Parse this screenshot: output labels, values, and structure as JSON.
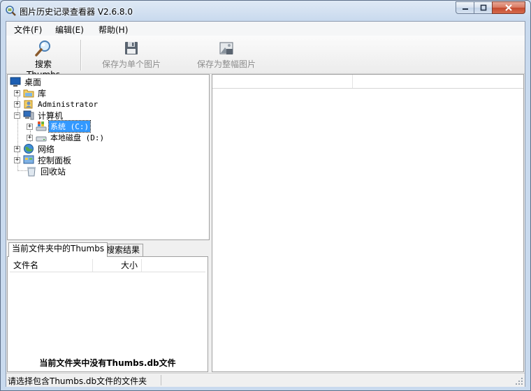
{
  "window": {
    "title": "图片历史记录查看器 V2.6.8.0"
  },
  "menu": {
    "file": "文件(F)",
    "edit": "编辑(E)",
    "help": "帮助(H)"
  },
  "toolbar": {
    "search_label": "搜索Thumbs",
    "save_single_label": "保存为单个图片",
    "save_whole_label": "保存为整幅图片"
  },
  "tree": {
    "desktop": "桌面",
    "library": "库",
    "administrator": "Administrator",
    "computer": "计算机",
    "drive_c": "系统 (C:)",
    "drive_d": "本地磁盘 (D:)",
    "network": "网络",
    "control_panel": "控制面板",
    "recycle_bin": "回收站"
  },
  "tabs": {
    "current_folder_thumbs": "当前文件夹中的Thumbs",
    "search_results": "搜索结果"
  },
  "file_list": {
    "columns": [
      "文件名",
      "大小"
    ],
    "empty_message": "当前文件夹中没有Thumbs.db文件"
  },
  "status": {
    "message": "请选择包含Thumbs.db文件的文件夹"
  },
  "colors": {
    "selection": "#3399ff",
    "title_glass": "#c9daee",
    "close_button": "#c44b2f"
  }
}
